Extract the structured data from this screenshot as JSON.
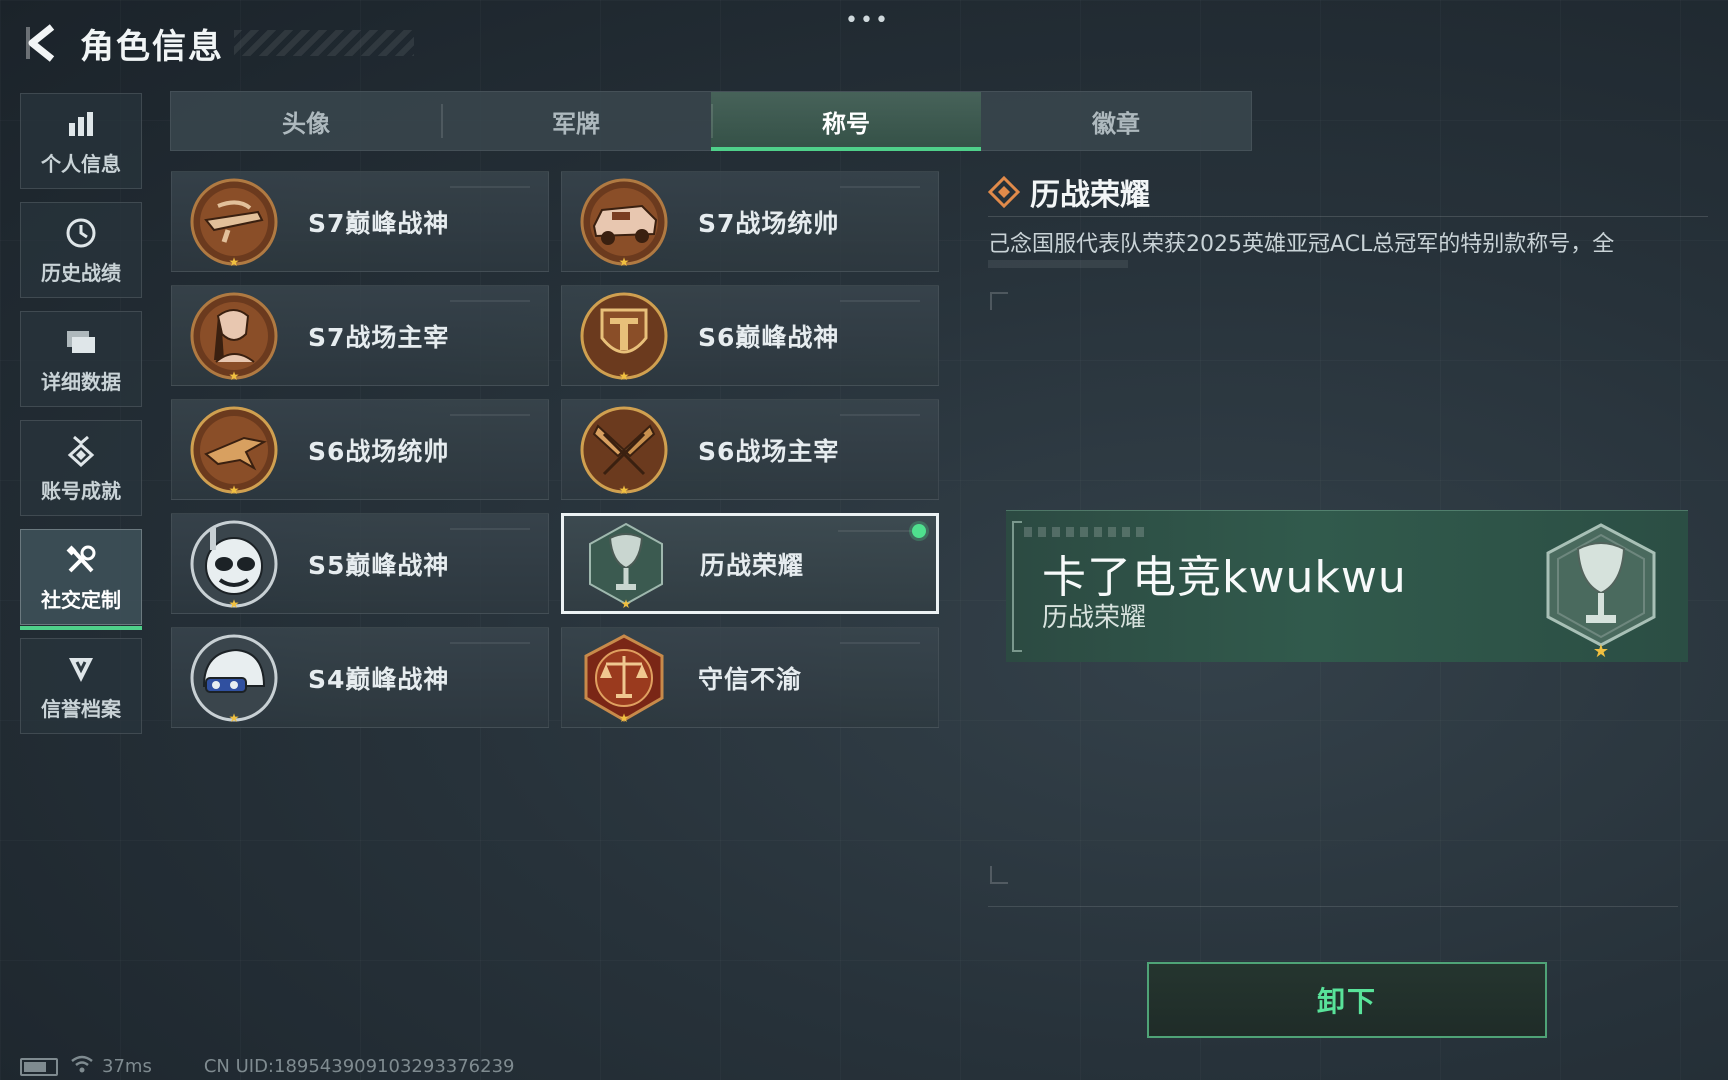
{
  "header": {
    "title": "角色信息",
    "more": "•••"
  },
  "sidebar": {
    "items": [
      {
        "label": "个人信息",
        "icon": "bar-chart-icon"
      },
      {
        "label": "历史战绩",
        "icon": "history-icon"
      },
      {
        "label": "详细数据",
        "icon": "folder-icon"
      },
      {
        "label": "账号成就",
        "icon": "achievement-icon"
      },
      {
        "label": "社交定制",
        "icon": "tools-icon",
        "active": true
      },
      {
        "label": "信誉档案",
        "icon": "shield-icon"
      }
    ]
  },
  "tabs": [
    {
      "label": "头像"
    },
    {
      "label": "军牌"
    },
    {
      "label": "称号",
      "active": true
    },
    {
      "label": "徽章"
    }
  ],
  "titles": [
    {
      "label": "S7巅峰战神",
      "icon": "crossbow-badge-icon"
    },
    {
      "label": "S7战场统帅",
      "icon": "vehicle-badge-icon"
    },
    {
      "label": "S7战场主宰",
      "icon": "soldier-badge-icon"
    },
    {
      "label": "S6巅峰战神",
      "icon": "t-shield-badge-icon"
    },
    {
      "label": "S6战场统帅",
      "icon": "jet-badge-icon"
    },
    {
      "label": "S6战场主宰",
      "icon": "crossed-flags-badge-icon"
    },
    {
      "label": "S5巅峰战神",
      "icon": "diver-badge-icon"
    },
    {
      "label": "历战荣耀",
      "icon": "trophy-badge-icon",
      "selected": true,
      "equipped": true
    },
    {
      "label": "S4巅峰战神",
      "icon": "helmet-badge-icon"
    },
    {
      "label": "守信不渝",
      "icon": "scales-badge-icon"
    }
  ],
  "detail": {
    "title": "历战荣耀",
    "description": "己念国服代表队荣获2025英雄亚冠ACL总冠军的特别款称号，全",
    "preview_name": "卡了电竞kwukwu",
    "preview_title": "历战荣耀",
    "action": "卸下"
  },
  "status": {
    "ping": "37ms",
    "uid": "CN UID:18954390910329337623​9"
  },
  "colors": {
    "accent": "#4fd08a",
    "bronze": "#a0602e",
    "teal": "#2f5a4c"
  }
}
